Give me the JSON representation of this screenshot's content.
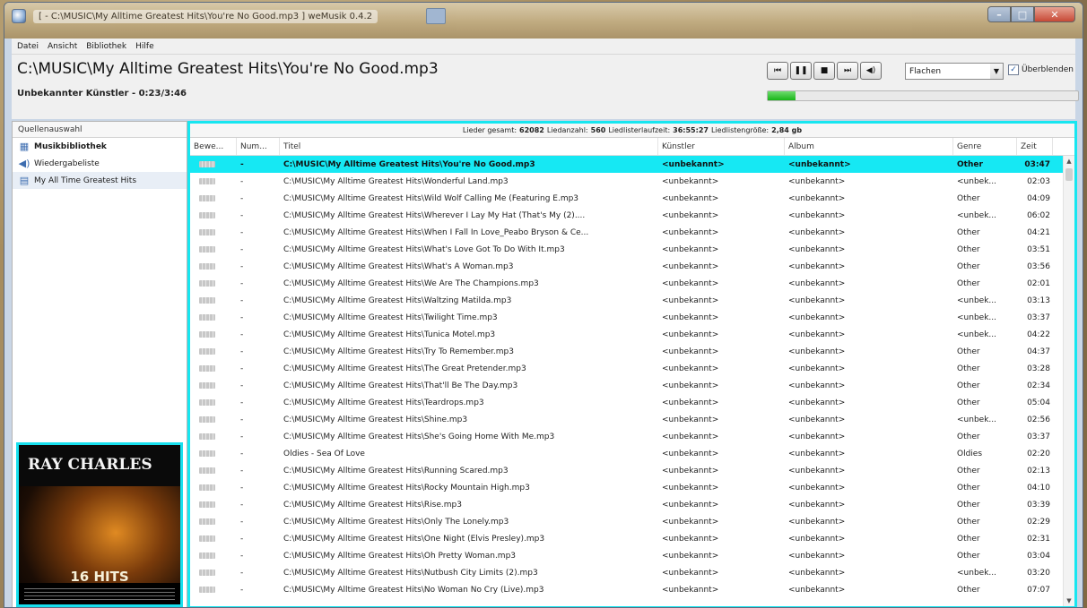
{
  "window": {
    "title": "[ - C:\\MUSIC\\My Alltime Greatest Hits\\You're No Good.mp3 ] weMusik 0.4.2"
  },
  "menu": [
    "Datei",
    "Ansicht",
    "Bibliothek",
    "Hilfe"
  ],
  "player": {
    "path": "C:\\MUSIC\\My Alltime Greatest Hits\\You're No Good.mp3",
    "artist": "Unbekannter Künstler",
    "time": " - 0:23/3:46",
    "progress": 0.09,
    "mode": "Flachen",
    "crossfade_label": "Überblenden",
    "crossfade_checked": true,
    "buttons": [
      "prev-icon",
      "pause-icon",
      "stop-icon",
      "next-icon",
      "volume-icon"
    ]
  },
  "sources": {
    "header": "Quellenauswahl",
    "items": [
      {
        "label": "Musikbibliothek",
        "icon": "library-icon"
      },
      {
        "label": "Wiedergabeliste",
        "icon": "playlist-icon"
      },
      {
        "label": "My All Time Greatest Hits",
        "icon": "list-icon"
      }
    ]
  },
  "cover": {
    "artist": "RAY CHARLES",
    "hits": "16 HITS"
  },
  "stats": {
    "songs_label": "Lieder gesamt:",
    "songs": "62082",
    "count_label": "Liedanzahl:",
    "count": "560",
    "duration_label": "Liedlisterlaufzeit:",
    "duration": "36:55:27",
    "size_label": "Liedlistengröße:",
    "size": "2,84 gb"
  },
  "columns": [
    "Bewe...",
    "Num...",
    "Titel",
    "Künstler",
    "Album",
    "Genre",
    "Zeit"
  ],
  "rows": [
    [
      "-",
      "C:\\MUSIC\\My Alltime Greatest Hits\\You're No Good.mp3",
      "<unbekannt>",
      "<unbekannt>",
      "Other",
      "03:47"
    ],
    [
      "-",
      "C:\\MUSIC\\My Alltime Greatest Hits\\Wonderful Land.mp3",
      "<unbekannt>",
      "<unbekannt>",
      "<unbek...",
      "02:03"
    ],
    [
      "-",
      "C:\\MUSIC\\My Alltime Greatest Hits\\Wild Wolf Calling Me (Featuring E.mp3",
      "<unbekannt>",
      "<unbekannt>",
      "Other",
      "04:09"
    ],
    [
      "-",
      "C:\\MUSIC\\My Alltime Greatest Hits\\Wherever I Lay My Hat (That's My (2)....",
      "<unbekannt>",
      "<unbekannt>",
      "<unbek...",
      "06:02"
    ],
    [
      "-",
      "C:\\MUSIC\\My Alltime Greatest Hits\\When I Fall In Love_Peabo Bryson & Ce...",
      "<unbekannt>",
      "<unbekannt>",
      "Other",
      "04:21"
    ],
    [
      "-",
      "C:\\MUSIC\\My Alltime Greatest Hits\\What's Love Got To Do With It.mp3",
      "<unbekannt>",
      "<unbekannt>",
      "Other",
      "03:51"
    ],
    [
      "-",
      "C:\\MUSIC\\My Alltime Greatest Hits\\What's A Woman.mp3",
      "<unbekannt>",
      "<unbekannt>",
      "Other",
      "03:56"
    ],
    [
      "-",
      "C:\\MUSIC\\My Alltime Greatest Hits\\We Are The Champions.mp3",
      "<unbekannt>",
      "<unbekannt>",
      "Other",
      "02:01"
    ],
    [
      "-",
      "C:\\MUSIC\\My Alltime Greatest Hits\\Waltzing Matilda.mp3",
      "<unbekannt>",
      "<unbekannt>",
      "<unbek...",
      "03:13"
    ],
    [
      "-",
      "C:\\MUSIC\\My Alltime Greatest Hits\\Twilight Time.mp3",
      "<unbekannt>",
      "<unbekannt>",
      "<unbek...",
      "03:37"
    ],
    [
      "-",
      "C:\\MUSIC\\My Alltime Greatest Hits\\Tunica Motel.mp3",
      "<unbekannt>",
      "<unbekannt>",
      "<unbek...",
      "04:22"
    ],
    [
      "-",
      "C:\\MUSIC\\My Alltime Greatest Hits\\Try To Remember.mp3",
      "<unbekannt>",
      "<unbekannt>",
      "Other",
      "04:37"
    ],
    [
      "-",
      "C:\\MUSIC\\My Alltime Greatest Hits\\The Great Pretender.mp3",
      "<unbekannt>",
      "<unbekannt>",
      "Other",
      "03:28"
    ],
    [
      "-",
      "C:\\MUSIC\\My Alltime Greatest Hits\\That'll Be The Day.mp3",
      "<unbekannt>",
      "<unbekannt>",
      "Other",
      "02:34"
    ],
    [
      "-",
      "C:\\MUSIC\\My Alltime Greatest Hits\\Teardrops.mp3",
      "<unbekannt>",
      "<unbekannt>",
      "Other",
      "05:04"
    ],
    [
      "-",
      "C:\\MUSIC\\My Alltime Greatest Hits\\Shine.mp3",
      "<unbekannt>",
      "<unbekannt>",
      "<unbek...",
      "02:56"
    ],
    [
      "-",
      "C:\\MUSIC\\My Alltime Greatest Hits\\She's Going Home With Me.mp3",
      "<unbekannt>",
      "<unbekannt>",
      "Other",
      "03:37"
    ],
    [
      "-",
      "Oldies - Sea Of Love",
      "<unbekannt>",
      "<unbekannt>",
      "Oldies",
      "02:20"
    ],
    [
      "-",
      "C:\\MUSIC\\My Alltime Greatest Hits\\Running Scared.mp3",
      "<unbekannt>",
      "<unbekannt>",
      "Other",
      "02:13"
    ],
    [
      "-",
      "C:\\MUSIC\\My Alltime Greatest Hits\\Rocky Mountain High.mp3",
      "<unbekannt>",
      "<unbekannt>",
      "Other",
      "04:10"
    ],
    [
      "-",
      "C:\\MUSIC\\My Alltime Greatest Hits\\Rise.mp3",
      "<unbekannt>",
      "<unbekannt>",
      "Other",
      "03:39"
    ],
    [
      "-",
      "C:\\MUSIC\\My Alltime Greatest Hits\\Only The Lonely.mp3",
      "<unbekannt>",
      "<unbekannt>",
      "Other",
      "02:29"
    ],
    [
      "-",
      "C:\\MUSIC\\My Alltime Greatest Hits\\One Night (Elvis Presley).mp3",
      "<unbekannt>",
      "<unbekannt>",
      "Other",
      "02:31"
    ],
    [
      "-",
      "C:\\MUSIC\\My Alltime Greatest Hits\\Oh Pretty Woman.mp3",
      "<unbekannt>",
      "<unbekannt>",
      "Other",
      "03:04"
    ],
    [
      "-",
      "C:\\MUSIC\\My Alltime Greatest Hits\\Nutbush City Limits (2).mp3",
      "<unbekannt>",
      "<unbekannt>",
      "<unbek...",
      "03:20"
    ],
    [
      "-",
      "C:\\MUSIC\\My Alltime Greatest Hits\\No Woman No Cry (Live).mp3",
      "<unbekannt>",
      "<unbekannt>",
      "Other",
      "07:07"
    ]
  ],
  "active_row": 0,
  "colors": {
    "highlight": "#16e8f3",
    "progress": "#18b518"
  }
}
